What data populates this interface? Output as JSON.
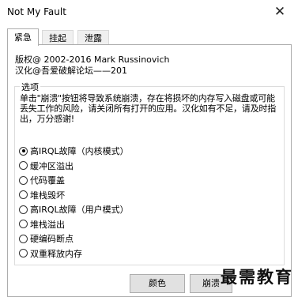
{
  "window": {
    "title": "Not My Fault",
    "close_glyph": "✕"
  },
  "tabs": [
    {
      "label": "紧急",
      "active": true
    },
    {
      "label": "挂起",
      "active": false
    },
    {
      "label": "泄露",
      "active": false
    }
  ],
  "panel": {
    "copyright_line1": "版权@ 2002-2016 Mark Russinovich",
    "copyright_line2": "汉化@吾爱破解论坛——201",
    "group_label": "选项",
    "description": "单击\"崩溃\"按钮将导致系统崩溃，存在将损坏的内存写入磁盘或可能丢失工作的风险，请关闭所有打开的应用。汉化如有不足，请及时指出，万分感谢!",
    "options": [
      {
        "label": "高IRQL故障（内核模式）",
        "selected": true
      },
      {
        "label": "缓冲区溢出",
        "selected": false
      },
      {
        "label": "代码覆盖",
        "selected": false
      },
      {
        "label": "堆栈毁坏",
        "selected": false
      },
      {
        "label": "高IRQL故障（用户模式）",
        "selected": false
      },
      {
        "label": "堆栈溢出",
        "selected": false
      },
      {
        "label": "硬编码断点",
        "selected": false
      },
      {
        "label": "双重释放内存",
        "selected": false
      }
    ]
  },
  "buttons": {
    "color": "颜色",
    "crash": "崩溃"
  },
  "watermark": "最需教育"
}
